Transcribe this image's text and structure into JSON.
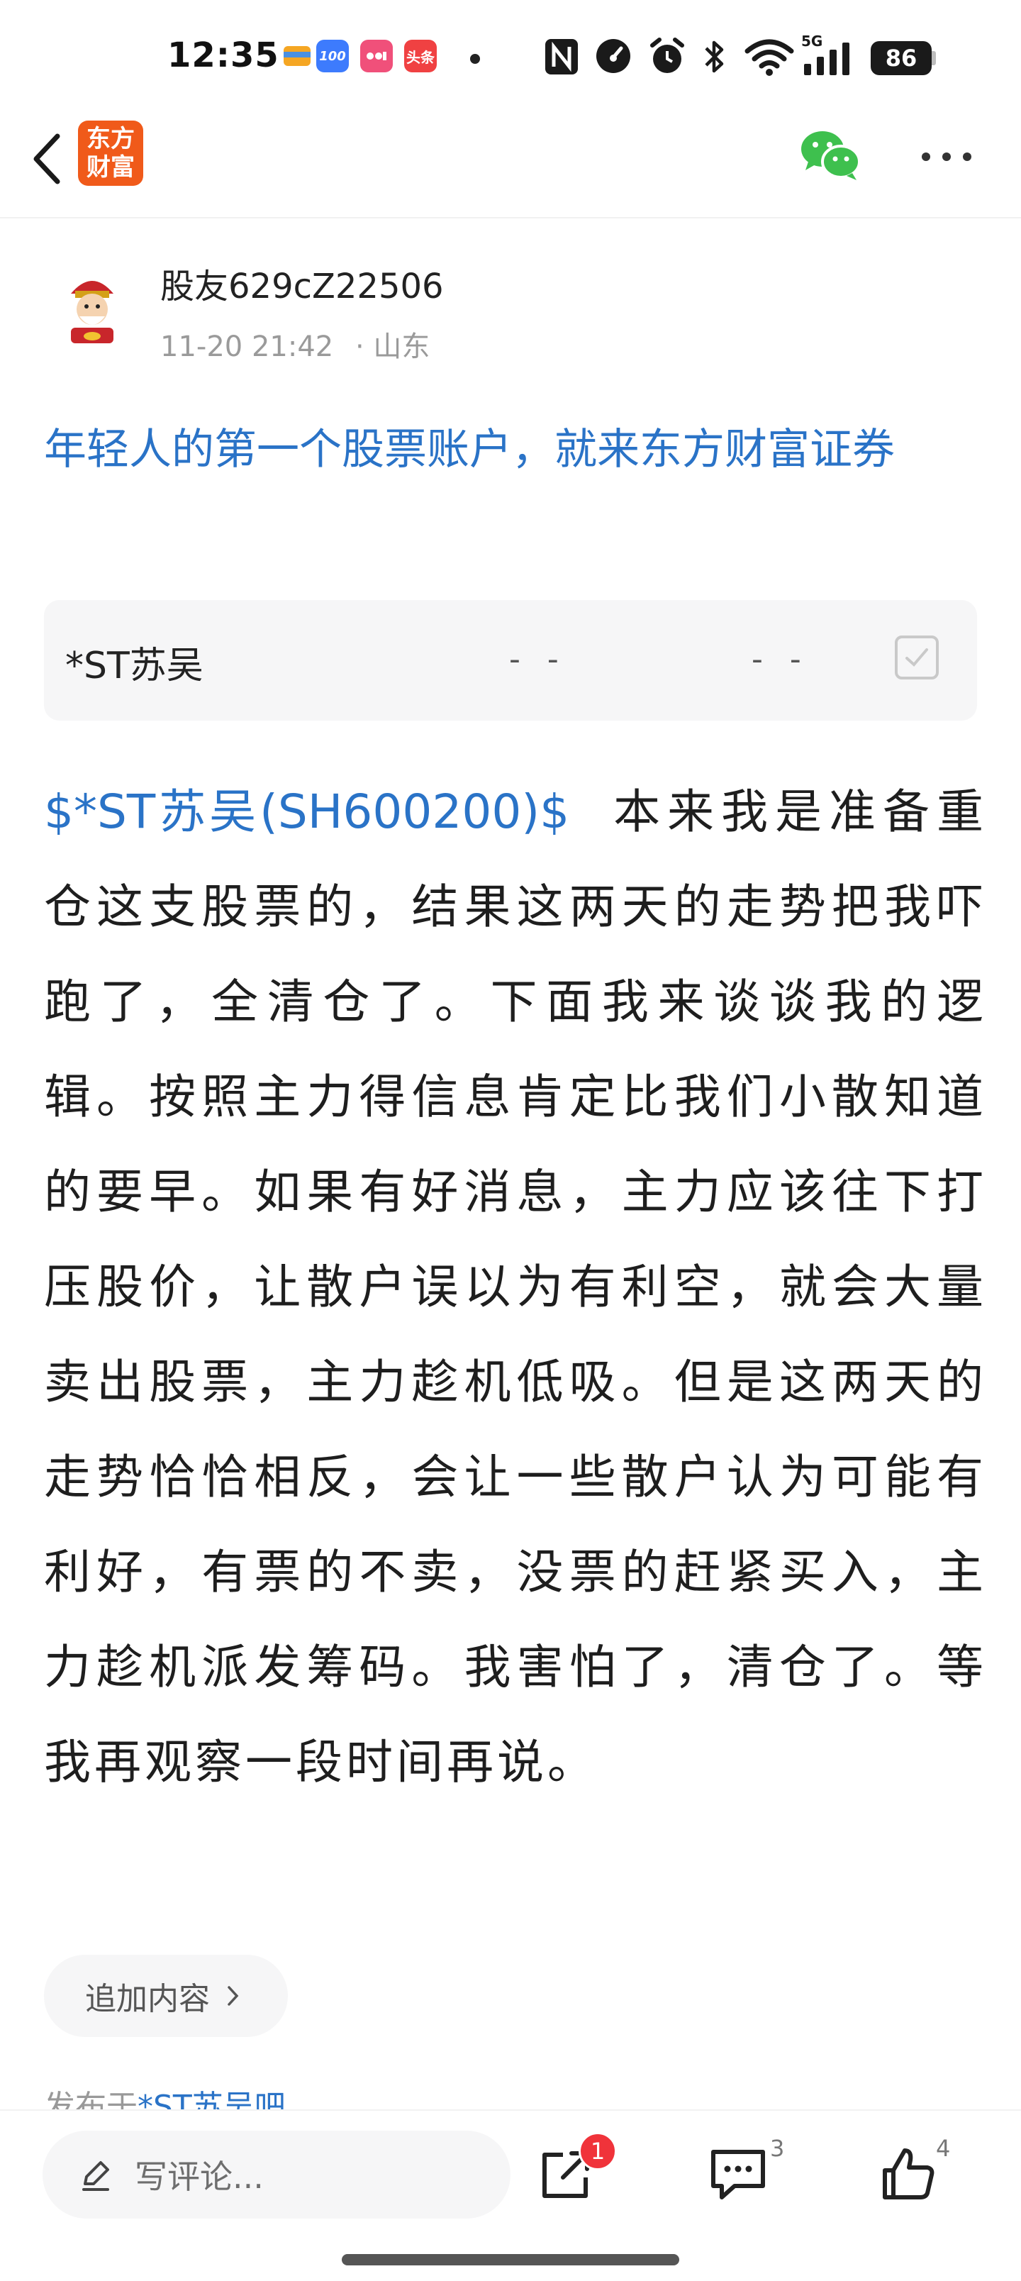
{
  "status_bar": {
    "time": "12:35",
    "notifications": [
      {
        "icon": "wallet-app-icon",
        "text": "",
        "color": "#f5a623"
      },
      {
        "icon": "taobao-100-app-icon",
        "text": "100",
        "color": "#3d7bfd"
      },
      {
        "icon": "xiaohongshu-app-icon",
        "text": "",
        "color": "#f0507a"
      },
      {
        "icon": "toutiao-app-icon",
        "text": "头条",
        "color": "#f04142"
      }
    ],
    "system_icons": [
      "nfc-icon",
      "speedometer-icon",
      "alarm-icon",
      "bluetooth-icon",
      "wifi-icon",
      "signal-5g-icon"
    ],
    "network_label": "5G",
    "battery": "86"
  },
  "nav": {
    "logo_text_line1": "东方",
    "logo_text_line2": "财富",
    "brand_color": "#f05a1a"
  },
  "author": {
    "name": "股友629cZ22506",
    "date": "11-20 21:42",
    "location": "山东",
    "separator": "·"
  },
  "ad": {
    "title": "年轻人的第一个股票账户，就来东方财富证券",
    "color": "#2a73c7"
  },
  "stock_card": {
    "name": "*ST苏吴",
    "price": "- -",
    "change": "- -"
  },
  "post": {
    "stock_link": "$*ST苏吴(SH600200)$",
    "text": "本来我是准备重仓这支股票的，结果这两天的走势把我吓跑了，全清仓了。下面我来谈谈我的逻辑。按照主力得信息肯定比我们小散知道的要早。如果有好消息，主力应该往下打压股价，让散户误以为有利空，就会大量卖出股票，主力趁机低吸。但是这两天的走势恰恰相反，会让一些散户认为可能有利好，有票的不卖，没票的赶紧买入，主力趁机派发筹码。我害怕了，清仓了。等我再观察一段时间再说。"
  },
  "append": {
    "label": "追加内容"
  },
  "published": {
    "prefix": "发布于",
    "bar_name": "*ST苏吴吧"
  },
  "bottom_bar": {
    "comment_placeholder": "写评论...",
    "share_badge": "1",
    "comment_count": "3",
    "like_count": "4"
  }
}
